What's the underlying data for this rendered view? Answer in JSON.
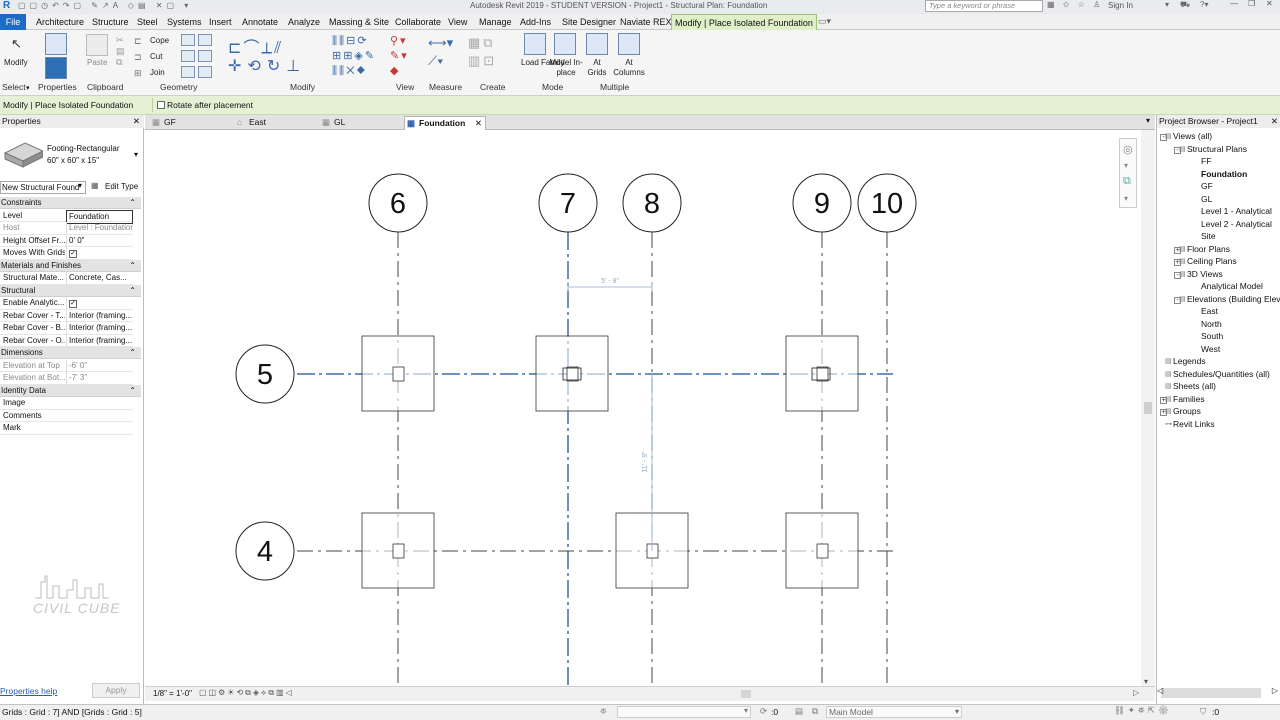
{
  "title": "Autodesk Revit 2019 - STUDENT VERSION - Project1 - Structural Plan: Foundation",
  "search_placeholder": "Type a keyword or phrase",
  "sign_in": "Sign In",
  "menus": [
    "Architecture",
    "Structure",
    "Steel",
    "Systems",
    "Insert",
    "Annotate",
    "Analyze",
    "Massing & Site",
    "Collaborate",
    "View",
    "Manage",
    "Add-Ins",
    "Site Designer",
    "Naviate REX",
    "Modify | Place Isolated Foundation"
  ],
  "file_tab": "File",
  "ribbon": {
    "modify": "Modify",
    "paste": "Paste",
    "cope": "Cope",
    "cut": "Cut",
    "join": "Join",
    "load_family": "Load Family",
    "model_inplace": "Model In-place",
    "at_grids": "At Grids",
    "at_columns": "At Columns",
    "groups": [
      "Select",
      "Properties",
      "Clipboard",
      "Geometry",
      "Modify",
      "View",
      "Measure",
      "Create",
      "Mode",
      "Multiple"
    ]
  },
  "optbar": {
    "context": "Modify | Place Isolated Foundation",
    "rotate": "Rotate after placement"
  },
  "properties": {
    "title": "Properties",
    "type_name": "Footing-Rectangular",
    "type_size": "60\" x 60\" x 15\"",
    "filter": "New Structural Found",
    "edit_type": "Edit Type",
    "sections": [
      {
        "name": "Constraints",
        "rows": [
          [
            "Level",
            "Foundation"
          ],
          [
            "Host",
            "Level : Foundation"
          ],
          [
            "Height Offset Fr...",
            "0' 0\""
          ],
          [
            "Moves With Grids",
            "✓"
          ]
        ]
      },
      {
        "name": "Materials and Finishes",
        "rows": [
          [
            "Structural Mate...",
            "Concrete, Cas..."
          ]
        ]
      },
      {
        "name": "Structural",
        "rows": [
          [
            "Enable Analytic...",
            "✓"
          ],
          [
            "Rebar Cover - T...",
            "Interior (framing..."
          ],
          [
            "Rebar Cover - B...",
            "Interior (framing..."
          ],
          [
            "Rebar Cover - O...",
            "Interior (framing..."
          ]
        ]
      },
      {
        "name": "Dimensions",
        "rows": [
          [
            "Elevation at Top",
            "-6' 0\""
          ],
          [
            "Elevation at Bot...",
            "-7' 3\""
          ]
        ]
      },
      {
        "name": "Identity Data",
        "rows": [
          [
            "Image",
            ""
          ],
          [
            "Comments",
            ""
          ],
          [
            "Mark",
            ""
          ]
        ]
      }
    ],
    "help": "Properties help",
    "apply": "Apply",
    "watermark": "CIVIL CUBE"
  },
  "view_tabs": [
    "GF",
    "East",
    "GL",
    "Foundation"
  ],
  "grids": {
    "vertical": [
      "6",
      "7",
      "8",
      "9",
      "10"
    ],
    "horizontal": [
      "5",
      "4"
    ]
  },
  "dimensions": {
    "horizontal": "5' - 9\"",
    "vertical": "11' - 9\""
  },
  "scale": "1/8\" = 1'-0\"",
  "browser": {
    "title": "Project Browser - Project1",
    "items": [
      {
        "label": "Views (all)",
        "level": 0,
        "toggle": "-"
      },
      {
        "label": "Structural Plans",
        "level": 1,
        "toggle": "-"
      },
      {
        "label": "FF",
        "level": 2
      },
      {
        "label": "Foundation",
        "level": 2,
        "bold": true
      },
      {
        "label": "GF",
        "level": 2
      },
      {
        "label": "GL",
        "level": 2
      },
      {
        "label": "Level 1 - Analytical",
        "level": 2
      },
      {
        "label": "Level 2 - Analytical",
        "level": 2
      },
      {
        "label": "Site",
        "level": 2
      },
      {
        "label": "Floor Plans",
        "level": 1,
        "toggle": "+"
      },
      {
        "label": "Ceiling Plans",
        "level": 1,
        "toggle": "+"
      },
      {
        "label": "3D Views",
        "level": 1,
        "toggle": "-"
      },
      {
        "label": "Analytical Model",
        "level": 2
      },
      {
        "label": "Elevations (Building Eleva",
        "level": 1,
        "toggle": "-"
      },
      {
        "label": "East",
        "level": 2
      },
      {
        "label": "North",
        "level": 2
      },
      {
        "label": "South",
        "level": 2
      },
      {
        "label": "West",
        "level": 2
      },
      {
        "label": "Legends",
        "level": 0
      },
      {
        "label": "Schedules/Quantities (all)",
        "level": 0
      },
      {
        "label": "Sheets (all)",
        "level": 0
      },
      {
        "label": "Families",
        "level": 0,
        "toggle": "+"
      },
      {
        "label": "Groups",
        "level": 0,
        "toggle": "+"
      },
      {
        "label": "Revit Links",
        "level": 0
      }
    ]
  },
  "status": {
    "text": "Grids : Grid : 7] AND [Grids : Grid : 5]",
    "zero": ":0",
    "model": "Main Model",
    "filter": ":0"
  }
}
